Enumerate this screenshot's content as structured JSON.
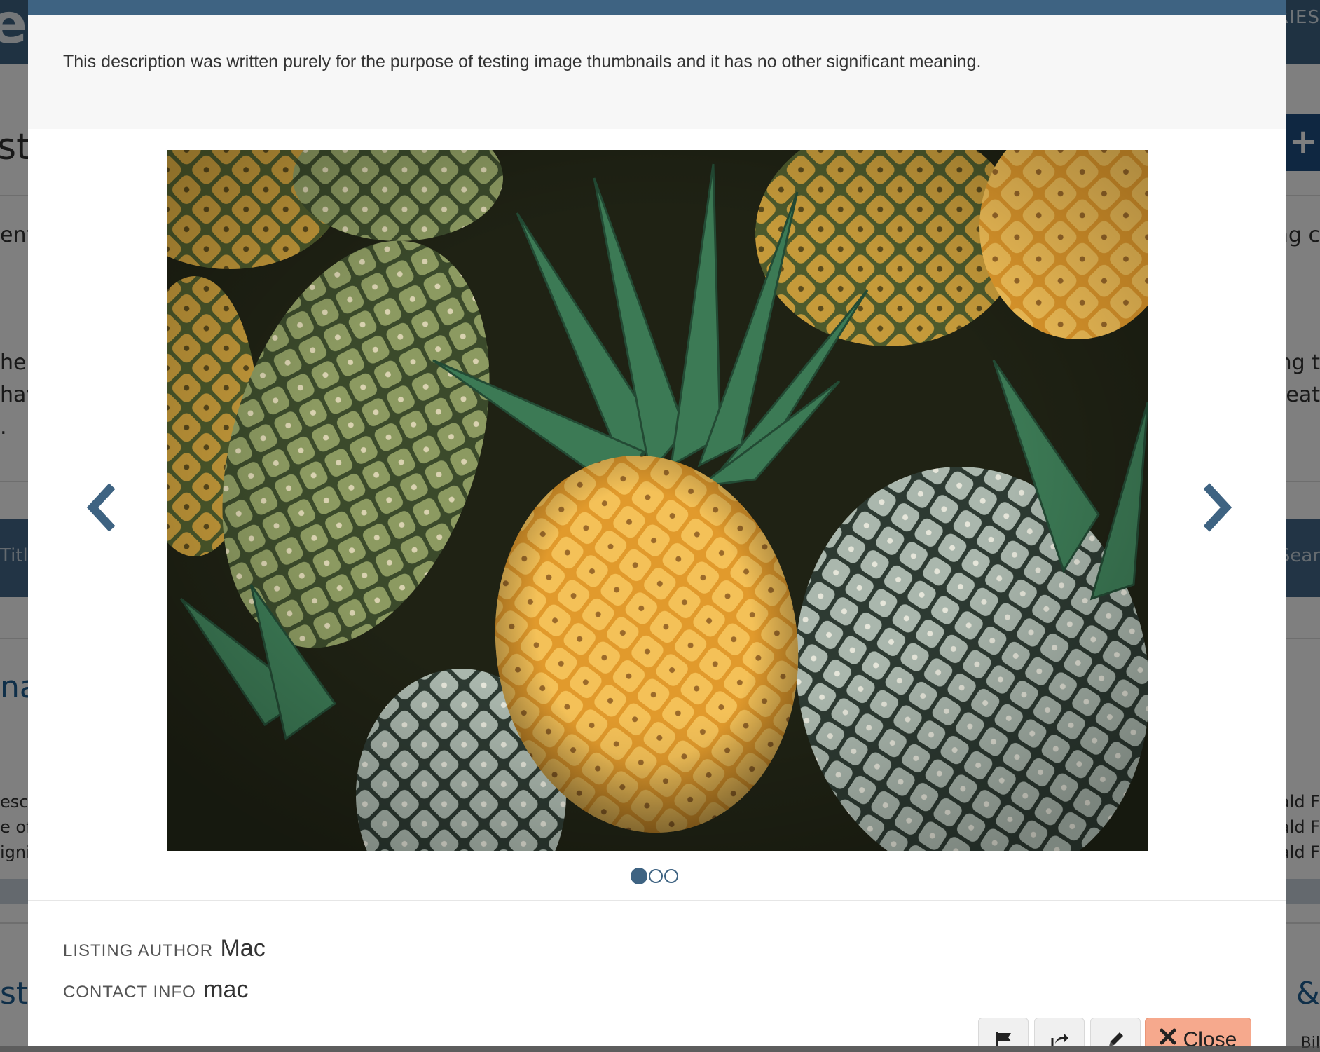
{
  "modal": {
    "description": "This description was written purely for the purpose of testing image thumbnails and it has no other significant meaning.",
    "carousel": {
      "slide_count": 3,
      "active_slide": 1,
      "image_subject": "pineapples"
    },
    "meta": {
      "author_label": "LISTING AUTHOR",
      "author_value": "Mac",
      "contact_label": "CONTACT INFO",
      "contact_value": "mac"
    },
    "footer": {
      "close_label": "Close"
    }
  },
  "background": {
    "logo_fragment": "e",
    "nav_fragment": "RIES",
    "fragments_left": [
      "st",
      "ent",
      "he",
      "hav",
      ".",
      "Titl",
      "na",
      "escri",
      "e of",
      "igni",
      "st I"
    ],
    "fragments_right": [
      "ng c",
      "ng t",
      "reat",
      "Sear",
      "nald F",
      "nald F",
      "nald F",
      "s &",
      "Bil"
    ]
  },
  "colors": {
    "primary": "#3e6382",
    "close_button": "#f6a98d",
    "description_bg": "#f7f7f7"
  }
}
